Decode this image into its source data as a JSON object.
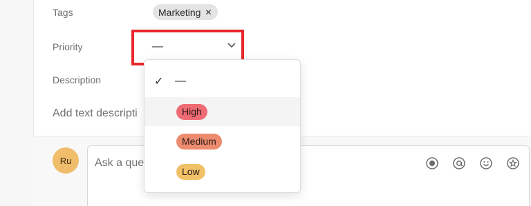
{
  "form": {
    "tags_label": "Tags",
    "tag_chip": "Marketing",
    "tag_remove": "✕",
    "priority_label": "Priority",
    "priority_value": "—",
    "description_label": "Description",
    "add_description": "Add text descripti"
  },
  "priority_menu": {
    "options": [
      {
        "label": "—",
        "selected": true,
        "color": null
      },
      {
        "label": "High",
        "selected": false,
        "color": "#ef6b73",
        "hovered": true
      },
      {
        "label": "Medium",
        "selected": false,
        "color": "#ec8b6d"
      },
      {
        "label": "Low",
        "selected": false,
        "color": "#f1c168"
      }
    ],
    "check": "✓"
  },
  "comment": {
    "avatar_initials": "Ru",
    "placeholder": "Ask a que",
    "icons": [
      "record-icon",
      "mention-icon",
      "emoji-icon",
      "star-icon"
    ]
  },
  "colors": {
    "highlight": "#e8262b",
    "avatar": "#f0bd6b"
  }
}
